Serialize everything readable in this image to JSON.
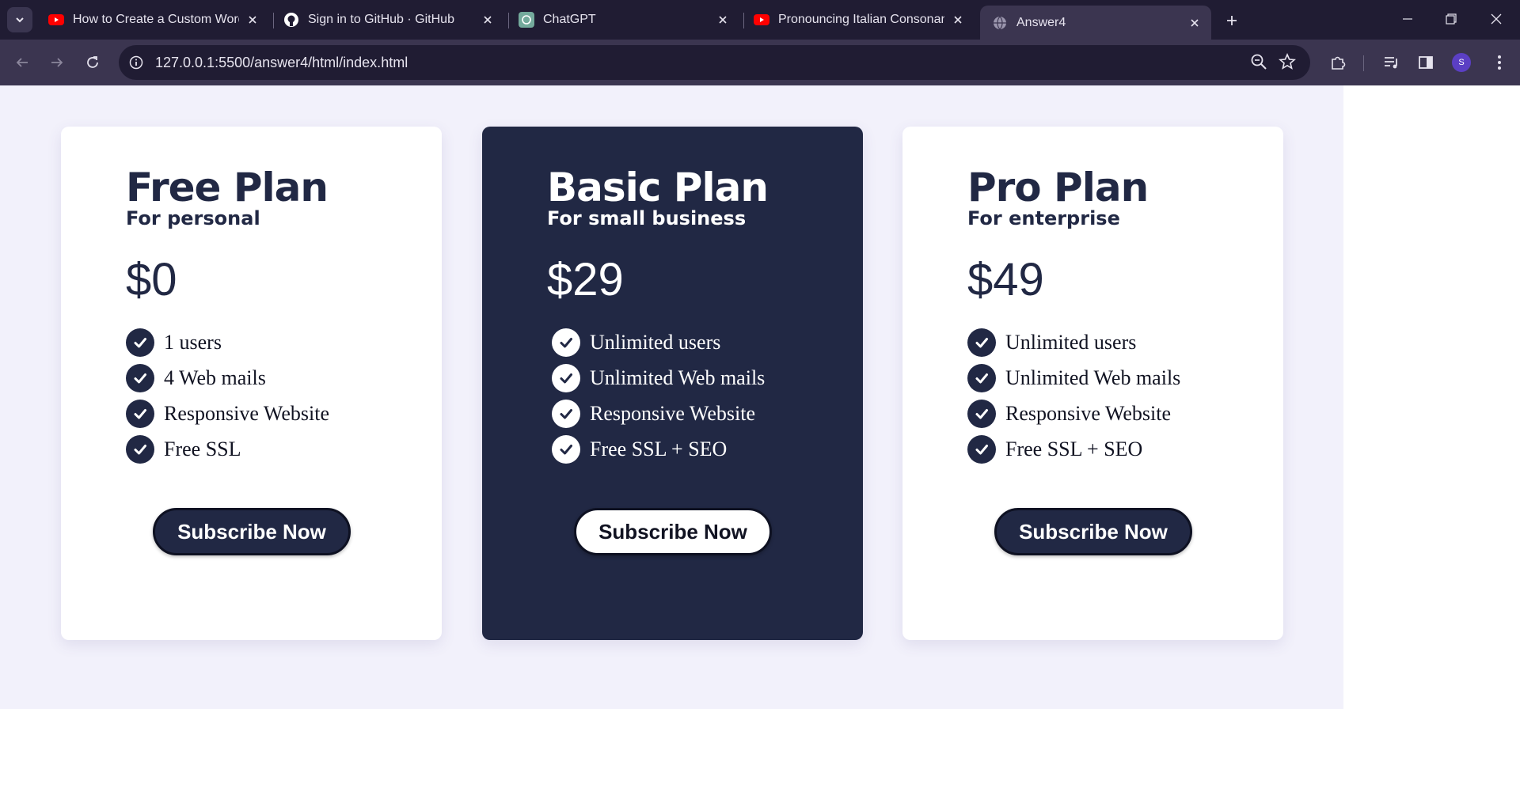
{
  "browser": {
    "tabs": [
      {
        "title": "How to Create a Custom WordP",
        "favicon": "youtube-icon"
      },
      {
        "title": "Sign in to GitHub · GitHub",
        "favicon": "github-icon"
      },
      {
        "title": "ChatGPT",
        "favicon": "chatgpt-icon"
      },
      {
        "title": "Pronouncing Italian Consonants",
        "favicon": "youtube-icon"
      },
      {
        "title": "Answer4",
        "favicon": "globe-icon",
        "active": true
      }
    ],
    "url": "127.0.0.1:5500/answer4/html/index.html",
    "profile_initial": "S"
  },
  "plans": [
    {
      "name": "Free Plan",
      "subtitle": "For personal",
      "price": "$0",
      "features": [
        "1 users",
        "4 Web mails",
        "Responsive Website",
        "Free SSL"
      ],
      "button": "Subscribe Now",
      "highlight": false
    },
    {
      "name": "Basic Plan",
      "subtitle": "For small business",
      "price": "$29",
      "features": [
        "Unlimited users",
        "Unlimited Web mails",
        "Responsive Website",
        "Free SSL + SEO"
      ],
      "button": "Subscribe Now",
      "highlight": true
    },
    {
      "name": "Pro Plan",
      "subtitle": "For enterprise",
      "price": "$49",
      "features": [
        "Unlimited users",
        "Unlimited Web mails",
        "Responsive Website",
        "Free SSL + SEO"
      ],
      "button": "Subscribe Now",
      "highlight": false
    }
  ],
  "colors": {
    "navy": "#212844",
    "page_bg": "#f2f1fb",
    "card_bg": "#ffffff"
  }
}
